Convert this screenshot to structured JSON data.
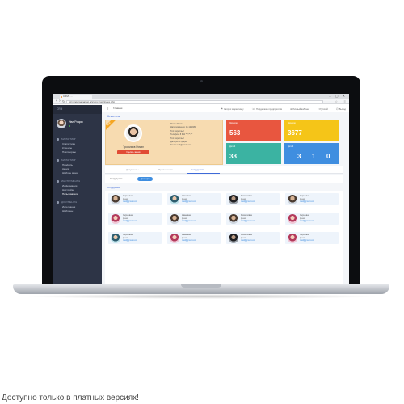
{
  "browser": {
    "tab_title": "CRM · ...",
    "url": "crm.ngamamarket.artcomc.com/index.php",
    "window_controls": "– ▢ ✕"
  },
  "sidebar": {
    "brand": "CRM",
    "user": {
      "name": "Ивл Ридин",
      "status": ""
    },
    "sections": [
      {
        "label": "Маркетинг",
        "items": [
          "Статистика",
          "Клиенты",
          "Платформы"
        ]
      },
      {
        "label": "Маркетинг",
        "items": [
          "Профиль",
          "Акция",
          "Шаблон меню"
        ]
      },
      {
        "label": "Инструменты",
        "items": [
          "Информация",
          "Настройки",
          "Пользователи"
        ]
      },
      {
        "label": "Документы",
        "items": [
          "Интеграция",
          "Шаблоны"
        ]
      }
    ]
  },
  "topbar": {
    "menu_label": "Главная",
    "items": [
      "Запрос маркетингу",
      "Поддержка предприятия",
      "Личный кабинет",
      "Русский",
      "Выход"
    ]
  },
  "page": {
    "title": "Клиенты"
  },
  "profile": {
    "ribbon": "NEW",
    "name": "Трофимов Роман",
    "button": "Сделать звонок",
    "info": [
      "Роман Роман",
      "Дата рождения: 11.12.1981",
      "Тип: взрослый",
      "Телефон: 8 952 ***-**-**",
      "Тип: взрослый",
      "Дата регистрации",
      "Email: mail@gmail.com"
    ]
  },
  "stats": {
    "red": {
      "label": "Звонков",
      "value": "563"
    },
    "yellow": {
      "label": "Звонков",
      "value": "3677"
    },
    "green": {
      "label": "Детей",
      "value": "38"
    },
    "blue": {
      "label": "Детей",
      "values": [
        "3",
        "1",
        "0"
      ]
    }
  },
  "tabs": [
    "Документы",
    "Приложения",
    "Сотрудники"
  ],
  "filters": {
    "lead": "Сотрудники:",
    "options": [
      "Тренеры",
      "",
      ""
    ]
  },
  "section_label": "Сотрудники",
  "people": [
    {
      "name": "Сергеевна",
      "second": "Денис",
      "email": "mail@gmail.com",
      "style": ""
    },
    {
      "name": "Ивановна",
      "second": "Денис",
      "email": "mail@gmail.com",
      "style": "teal"
    },
    {
      "name": "Михайловна",
      "second": "Денис",
      "email": "mail@gmail.com",
      "style": "dark"
    },
    {
      "name": "Сергеевна",
      "second": "Денис",
      "email": "mail@gmail.com",
      "style": ""
    },
    {
      "name": "Сергеевна",
      "second": "Денис",
      "email": "mail@gmail.com",
      "style": "pink"
    },
    {
      "name": "Ивановна",
      "second": "Денис",
      "email": "mail@gmail.com",
      "style": ""
    },
    {
      "name": "Михайловна",
      "second": "Денис",
      "email": "mail@gmail.com",
      "style": ""
    },
    {
      "name": "Сергеевна",
      "second": "Денис",
      "email": "mail@gmail.com",
      "style": "pink"
    },
    {
      "name": "Сергеевна",
      "second": "Денис",
      "email": "mail@gmail.com",
      "style": "teal"
    },
    {
      "name": "Ивановна",
      "second": "Денис",
      "email": "mail@gmail.com",
      "style": "pink"
    },
    {
      "name": "Михайловна",
      "second": "Денис",
      "email": "mail@gmail.com",
      "style": "dark"
    },
    {
      "name": "Сергеевна",
      "second": "Денис",
      "email": "mail@gmail.com",
      "style": "pink"
    }
  ],
  "caption": "Доступно только в платных версиях!",
  "colors": {
    "accent": "#3f6ad8",
    "sidebar": "#2d3446",
    "red": "#e8563f",
    "yellow": "#f5c518",
    "green": "#3bb3a2",
    "blue": "#3f8ee0",
    "profile_bg": "#f7dbb0"
  }
}
